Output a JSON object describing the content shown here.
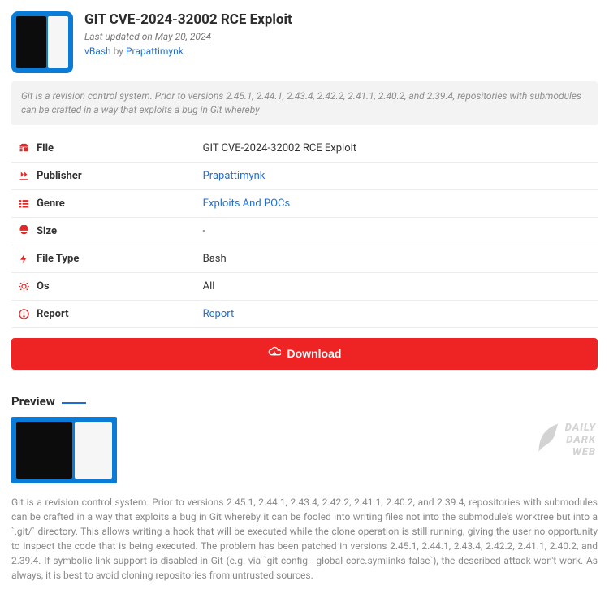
{
  "title": "GIT CVE-2024-32002 RCE Exploit",
  "updated_prefix": "Last updated on ",
  "updated_date": "May 20, 2024",
  "byline_type": "vBash",
  "byline_by": " by ",
  "byline_author": "Prapattimynk",
  "summary": "Git is a revision control system. Prior to versions 2.45.1, 2.44.1, 2.43.4, 2.42.2, 2.41.1, 2.40.2, and 2.39.4, repositories with submodules can be crafted in a way that exploits a bug in Git whereby",
  "rows": [
    {
      "label": "File",
      "value": "GIT CVE-2024-32002 RCE Exploit",
      "is_link": false
    },
    {
      "label": "Publisher",
      "value": "Prapattimynk",
      "is_link": true
    },
    {
      "label": "Genre",
      "value": "Exploits And POCs",
      "is_link": true
    },
    {
      "label": "Size",
      "value": "-",
      "is_link": false
    },
    {
      "label": "File Type",
      "value": "Bash",
      "is_link": false
    },
    {
      "label": "Os",
      "value": "All",
      "is_link": false
    },
    {
      "label": "Report",
      "value": "Report",
      "is_link": true
    }
  ],
  "download_label": "Download",
  "preview_heading": "Preview",
  "watermark_lines": [
    "DAILY",
    "DARK",
    "WEB"
  ],
  "description": "Git is a revision control system. Prior to versions 2.45.1, 2.44.1, 2.43.4, 2.42.2, 2.41.1, 2.40.2, and 2.39.4, repositories with submodules can be crafted in a way that exploits a bug in Git whereby it can be fooled into writing files not into the submodule's worktree but into a `.git/` directory. This allows writing a hook that will be executed while the clone operation is still running, giving the user no opportunity to inspect the code that is being executed. The problem has been patched in versions 2.45.1, 2.44.1, 2.43.4, 2.42.2, 2.41.1, 2.40.2, and 2.39.4. If symbolic link support is disabled in Git (e.g. via `git config --global core.symlinks false`), the described attack won't work. As always, it is best to avoid cloning repositories from untrusted sources."
}
